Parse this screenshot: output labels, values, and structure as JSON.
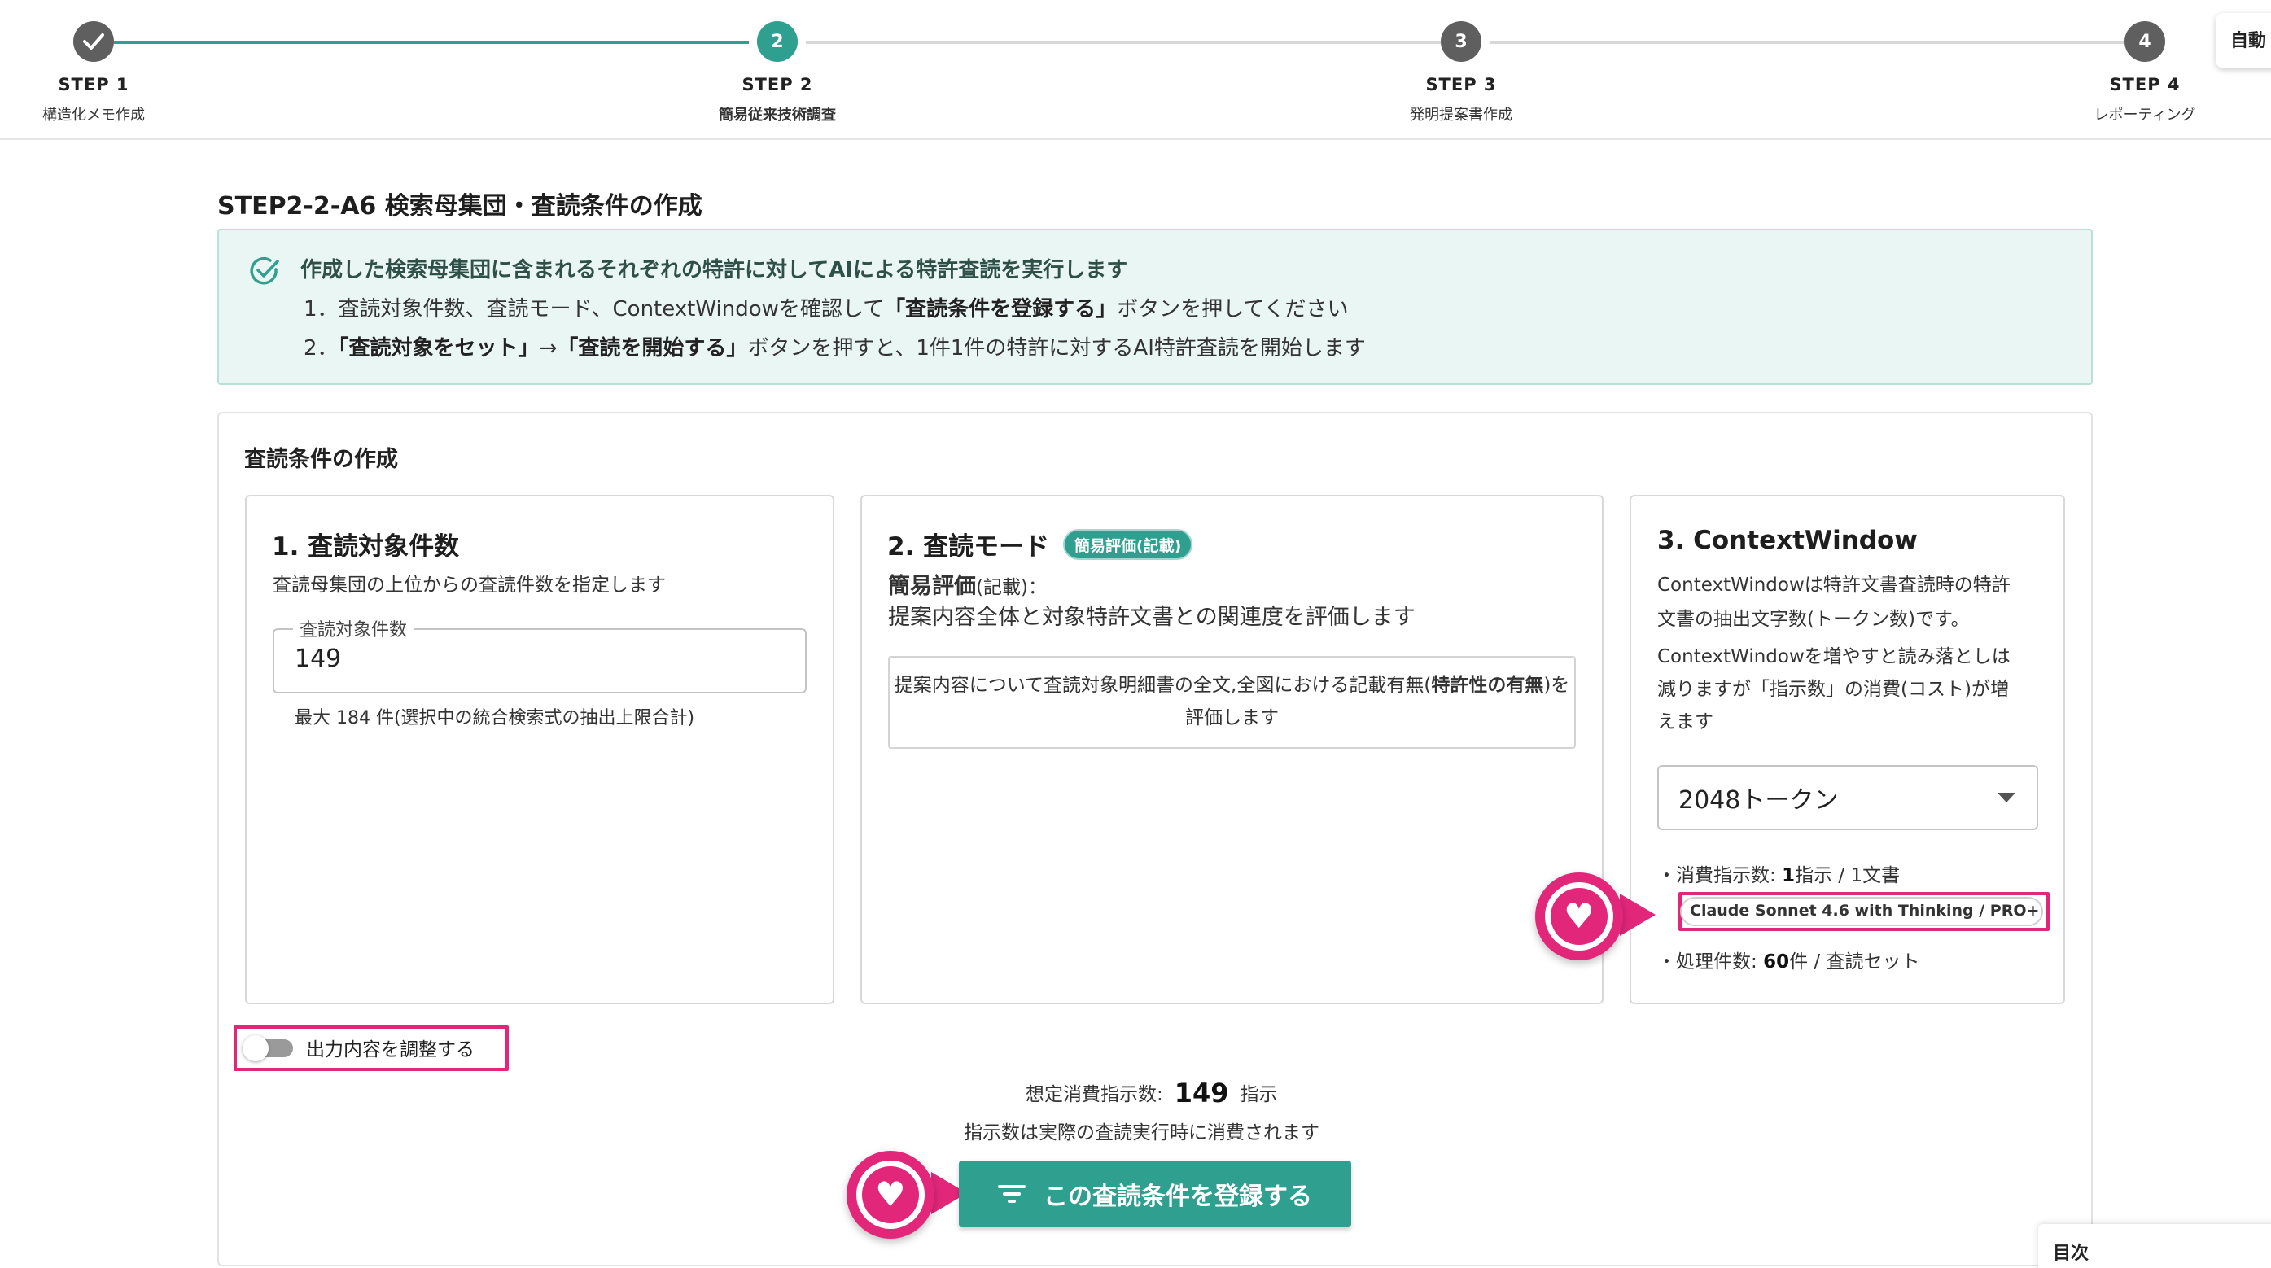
{
  "stepper": {
    "steps": [
      {
        "num": "",
        "title": "STEP 1",
        "sub": "構造化メモ作成",
        "state": "done"
      },
      {
        "num": "2",
        "title": "STEP 2",
        "sub": "簡易従来技術調査",
        "state": "active"
      },
      {
        "num": "3",
        "title": "STEP 3",
        "sub": "発明提案書作成",
        "state": "pending"
      },
      {
        "num": "4",
        "title": "STEP 4",
        "sub": "レポーティング",
        "state": "pending"
      }
    ],
    "side_tab": "自動"
  },
  "page_title": "STEP2-2-A6 検索母集団・査読条件の作成",
  "info": {
    "headline": "作成した検索母集団に含まれるそれぞれの特許に対してAIによる特許査読を実行します",
    "l2_pre": "1．査読対象件数、査読モード、ContextWindowを確認して",
    "l2_bold": "「査読条件を登録する」",
    "l2_post": "ボタンを押してください",
    "l3_pre": "2．",
    "l3_bold1": "「査読対象をセット」",
    "l3_arrow": "→",
    "l3_bold2": "「査読を開始する」",
    "l3_post": "ボタンを押すと、1件1件の特許に対するAI特許査読を開始します"
  },
  "card_title": "査読条件の作成",
  "panel1": {
    "title": "1. 査読対象件数",
    "desc": "査読母集団の上位からの査読件数を指定します",
    "field_label": "査読対象件数",
    "field_value": "149",
    "help": "最大 184 件(選択中の統合検索式の抽出上限合計)"
  },
  "panel2": {
    "title": "2. 査読モード",
    "badge": "簡易評価(記載)",
    "mode_name": "簡易評価",
    "mode_suffix": "(記載)：",
    "mode_desc": "提案内容全体と対象特許文書との関連度を評価します",
    "box_pre": "提案内容について査読対象明細書の全文,全図における記載有無(",
    "box_bold": "特許性の有無",
    "box_post": ")を評価します"
  },
  "panel3": {
    "title": "3. ContextWindow",
    "desc1a": "ContextWindowは特許文書査読時の特許",
    "desc1b": "文書の抽出文字数(トークン数)です。",
    "desc2a": "ContextWindowを増やすと読み落としは",
    "desc2b": "減りますが「指示数」の消費(コスト)が増",
    "desc2c": "えます",
    "select_value": "2048トークン",
    "bullet1_pre": "・消費指示数: ",
    "bullet1_bold": "1",
    "bullet1_post": "指示 / 1文書",
    "model_chip": "Claude Sonnet 4.6 with Thinking / PRO+ / ...",
    "bullet2_pre": "・処理件数: ",
    "bullet2_bold": "60",
    "bullet2_post": "件 / 査読セット"
  },
  "toggle_label": "出力内容を調整する",
  "estimate": {
    "label": "想定消費指示数:",
    "value": "149",
    "unit": "指示",
    "note": "指示数は実際の査読実行時に消費されます"
  },
  "submit_label": "この査読条件を登録する",
  "toc_label": "目次",
  "colors": {
    "accent": "#2f9f8f",
    "highlight": "#e2277a"
  }
}
